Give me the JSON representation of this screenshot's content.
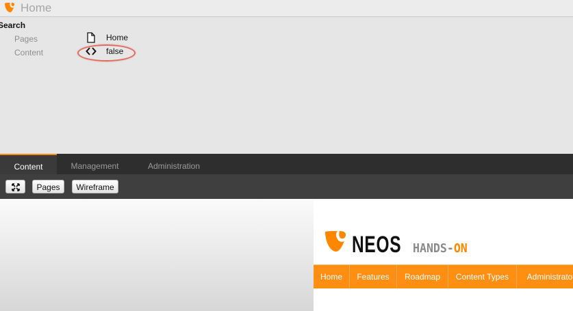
{
  "titlebar": {
    "title": "Home",
    "logo_icon": "typo3-logo"
  },
  "search": {
    "heading": "Search",
    "results": [
      {
        "label": "Pages",
        "icon": "document-icon",
        "value": "Home"
      },
      {
        "label": "Content",
        "icon": "code-icon",
        "value": "false"
      }
    ],
    "highlight_color": "#e06c5f"
  },
  "module_tabs": [
    {
      "label": "Content",
      "active": true
    },
    {
      "label": "Management",
      "active": false
    },
    {
      "label": "Administration",
      "active": false
    }
  ],
  "toolbar": {
    "fullscreen_icon": "fullscreen-icon",
    "pages_label": "Pages",
    "wireframe_label": "Wireframe"
  },
  "website": {
    "brand": "NEOS",
    "tagline_part1": "HANDS-",
    "tagline_part2": "ON",
    "nav": [
      "Home",
      "Features",
      "Roadmap",
      "Content Types",
      "Administrator"
    ],
    "accent_color": "#ff8700"
  }
}
